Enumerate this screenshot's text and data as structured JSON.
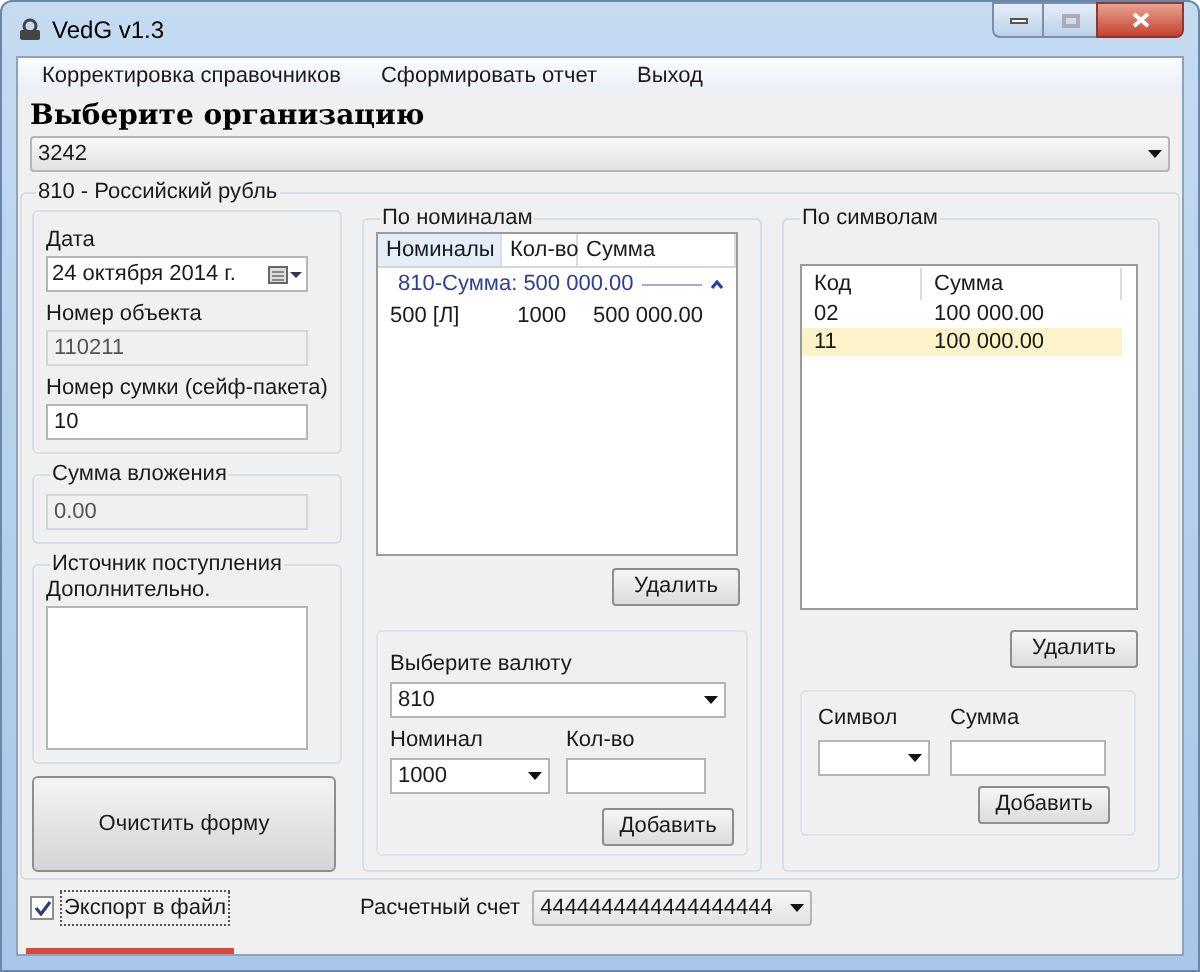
{
  "window": {
    "title": "VedG v1.3"
  },
  "menu": [
    {
      "label": "Корректировка справочников"
    },
    {
      "label": "Сформировать отчет"
    },
    {
      "label": "Выход"
    }
  ],
  "heading": "Выберите организацию",
  "organization": {
    "value": "3242"
  },
  "currency_group": {
    "title": "810 - Российский рубль"
  },
  "date": {
    "label": "Дата",
    "value": "24  октября  2014 г."
  },
  "object_number": {
    "label": "Номер объекта",
    "value": "110211",
    "disabled": true
  },
  "bag_number": {
    "label": "Номер сумки (сейф-пакета)",
    "value": "10",
    "disabled": false
  },
  "investment": {
    "title": "Сумма вложения",
    "value": "0.00",
    "disabled": true
  },
  "source": {
    "title": "Источник поступления",
    "label": "Дополнительно."
  },
  "clear_button": "Очистить форму",
  "denominations": {
    "title": "По номиналам",
    "columns": [
      "Номиналы",
      "Кол-во",
      "Сумма"
    ],
    "group": {
      "label": "810-Сумма: 500 000.00",
      "expanded": true
    },
    "rows": [
      {
        "cells": [
          "500 [Л]",
          "1000",
          "500 000.00"
        ]
      }
    ],
    "delete_button": "Удалить",
    "currency_label": "Выберите валюту",
    "currency_value": "810",
    "nominal_label": "Номинал",
    "nominal_value": "1000",
    "count_label": "Кол-во",
    "add_button": "Добавить"
  },
  "symbols": {
    "title": "По символам",
    "columns": [
      "Код",
      "Сумма"
    ],
    "rows": [
      {
        "cells": [
          "02",
          "100 000.00"
        ],
        "selected": false
      },
      {
        "cells": [
          "11",
          "100 000.00"
        ],
        "selected": true
      }
    ],
    "delete_button": "Удалить",
    "symbol_label": "Символ",
    "sum_label": "Сумма",
    "add_button": "Добавить"
  },
  "export": {
    "label": "Экспорт в файл",
    "checked": true
  },
  "account": {
    "label": "Расчетный счет",
    "value": "4444444444444444444"
  }
}
